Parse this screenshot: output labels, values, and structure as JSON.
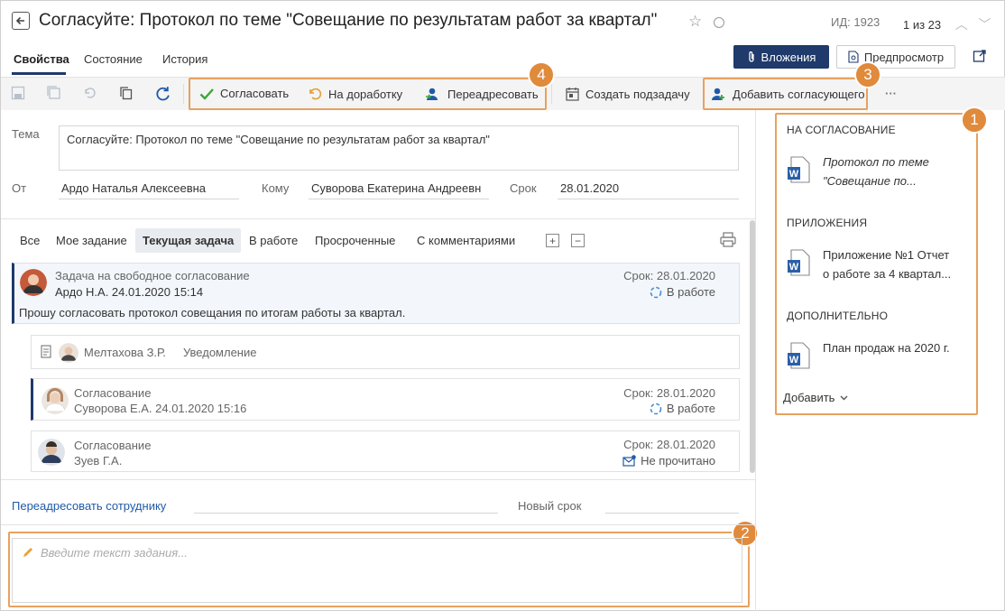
{
  "header": {
    "title": "Согласуйте: Протокол по теме \"Совещание по результатам работ за квартал\"",
    "id_label": "ИД: 1923",
    "pager": "1 из 23"
  },
  "tabs": [
    "Свойства",
    "Состояние",
    "История"
  ],
  "actions": {
    "attachments": "Вложения",
    "preview": "Предпросмотр"
  },
  "toolbar": {
    "approve": "Согласовать",
    "rework": "На доработку",
    "forward": "Переадресовать",
    "create_subtask": "Создать подзадачу",
    "add_approver": "Добавить согласующего",
    "more": "···"
  },
  "form": {
    "theme_label": "Тема",
    "theme_value": "Согласуйте: Протокол по теме \"Совещание по результатам работ за квартал\"",
    "from_label": "От",
    "from_value": "Ардо Наталья Алексеевна",
    "to_label": "Кому",
    "to_value": "Суворова Екатерина Андреевн",
    "due_label": "Срок",
    "due_value": "28.01.2020"
  },
  "filters": [
    "Все",
    "Мое задание",
    "Текущая задача",
    "В работе",
    "Просроченные",
    "С комментариями"
  ],
  "tasks": {
    "main": {
      "title": "Задача на свободное согласование",
      "author": "Ардо Н.А.  24.01.2020 15:14",
      "due": "Срок: 28.01.2020",
      "status": "В работе",
      "text": "Прошу согласовать протокол совещания по итогам работы за квартал."
    },
    "notice": {
      "name": "Мелтахова З.Р.",
      "type": "Уведомление"
    },
    "sub1": {
      "title": "Согласование",
      "author": "Суворова Е.А.  24.01.2020 15:16",
      "due": "Срок: 28.01.2020",
      "status": "В работе"
    },
    "sub2": {
      "title": "Согласование",
      "author": "Зуев Г.А.",
      "due": "Срок: 28.01.2020",
      "status": "Не прочитано"
    }
  },
  "bottom": {
    "forward_link": "Переадресовать сотруднику",
    "new_due": "Новый срок",
    "composer_placeholder": "Введите текст задания..."
  },
  "right_panel": {
    "approval_title": "НА СОГЛАСОВАНИЕ",
    "approval_doc_line1": "Протокол по теме",
    "approval_doc_line2": "\"Совещание по...",
    "attachments_title": "ПРИЛОЖЕНИЯ",
    "attachment_line1": "Приложение №1 Отчет",
    "attachment_line2": "о работе за 4 квартал...",
    "extra_title": "ДОПОЛНИТЕЛЬНО",
    "extra_doc": "План продаж на 2020 г.",
    "add": "Добавить"
  },
  "badges": [
    "1",
    "2",
    "3",
    "4"
  ],
  "colors": {
    "accent": "#1f3a6b",
    "highlight": "#e8a15e",
    "badge": "#e08a3c",
    "approve_green": "#3aa835",
    "word_blue": "#2b5fa8"
  }
}
